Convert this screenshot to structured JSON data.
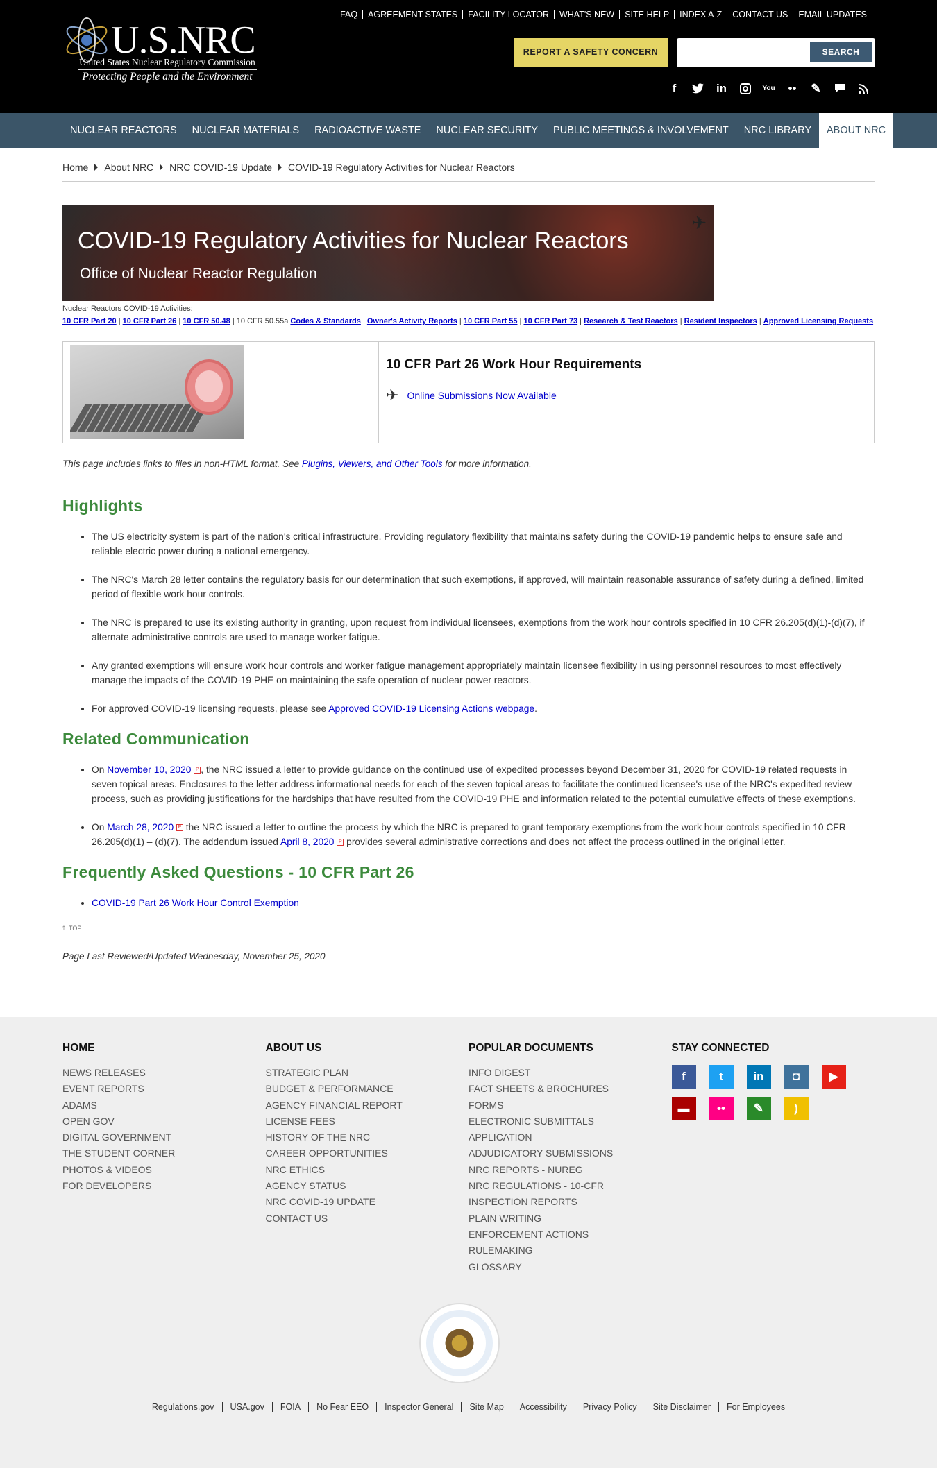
{
  "header": {
    "logo_title": "U.S.NRC",
    "logo_subtitle": "United States Nuclear Regulatory Commission",
    "logo_tagline": "Protecting People and the Environment",
    "utility_links": [
      "FAQ",
      "AGREEMENT STATES",
      "FACILITY LOCATOR",
      "WHAT'S NEW",
      "SITE HELP",
      "INDEX A-Z",
      "CONTACT US",
      "EMAIL UPDATES"
    ],
    "report_button": "REPORT A SAFETY CONCERN",
    "search_button": "SEARCH",
    "search_value": "",
    "social_icons": [
      "facebook-icon",
      "twitter-icon",
      "linkedin-icon",
      "instagram-icon",
      "youtube-icon",
      "flickr-icon",
      "blog-icon",
      "comment-icon",
      "rss-icon"
    ]
  },
  "nav": {
    "items": [
      "NUCLEAR REACTORS",
      "NUCLEAR MATERIALS",
      "RADIOACTIVE WASTE",
      "NUCLEAR SECURITY",
      "PUBLIC MEETINGS & INVOLVEMENT",
      "NRC LIBRARY",
      "ABOUT NRC"
    ],
    "active": "ABOUT NRC"
  },
  "breadcrumb": [
    "Home",
    "About NRC",
    "NRC COVID-19 Update",
    "COVID-19 Regulatory Activities for Nuclear Reactors"
  ],
  "banner": {
    "title": "COVID-19 Regulatory Activities for Nuclear Reactors",
    "subtitle": "Office of Nuclear Reactor Regulation"
  },
  "activities": {
    "label": "Nuclear Reactors COVID-19 Activities:",
    "links": [
      "10 CFR Part 20",
      "10 CFR Part 26",
      "10 CFR 50.48"
    ],
    "plain": "10 CFR 50.55a",
    "links2": [
      "Codes & Standards",
      "Owner's Activity Reports",
      "10 CFR Part 55",
      "10 CFR Part 73",
      "Research & Test Reactors",
      "Resident Inspectors",
      "Approved Licensing Requests"
    ]
  },
  "feature": {
    "title": "10 CFR Part 26 Work Hour Requirements",
    "link": "Online Submissions Now Available"
  },
  "note": {
    "before": "This page includes links to files in non-HTML format. See ",
    "link": "Plugins, Viewers, and Other Tools",
    "after": " for more information."
  },
  "highlights": {
    "heading": "Highlights",
    "items": [
      "The US electricity system is part of the nation's critical infrastructure. Providing regulatory flexibility that maintains safety during the COVID-19 pandemic helps to ensure safe and reliable electric power during a national emergency.",
      "The NRC's March 28 letter contains the regulatory basis for our determination that such exemptions, if approved, will maintain reasonable assurance of safety during a defined, limited period of flexible work hour controls.",
      "The NRC is prepared to use its existing authority in granting, upon request from individual licensees, exemptions from the work hour controls specified in 10 CFR 26.205(d)(1)-(d)(7), if alternate administrative controls are used to manage worker fatigue.",
      "Any granted exemptions will ensure work hour controls and worker fatigue management appropriately maintain licensee flexibility in using personnel resources to most effectively manage the impacts of the COVID-19 PHE on maintaining the safe operation of nuclear power reactors."
    ],
    "last_before": "For approved COVID-19 licensing requests, please see ",
    "last_link": "Approved COVID-19 Licensing Actions webpage",
    "last_after": "."
  },
  "related": {
    "heading": "Related Communication",
    "item1_on": "On ",
    "item1_link": "November 10, 2020",
    "item1_text": ", the NRC issued a letter to provide guidance on the continued use of expedited processes beyond December 31, 2020 for COVID-19 related requests in seven topical areas. Enclosures to the letter address informational needs for each of the seven topical areas to facilitate the continued licensee's use of the NRC's expedited review process, such as providing justifications for the hardships that have resulted from the COVID-19 PHE and information related to the potential cumulative effects of these exemptions.",
    "item2_on": "On ",
    "item2_link": "March 28, 2020",
    "item2_text": " the NRC issued a letter to outline the process by which the NRC is prepared to grant temporary exemptions from the work hour controls specified in 10 CFR 26.205(d)(1) – (d)(7). The addendum issued ",
    "item2_link2": "April 8, 2020",
    "item2_text2": " provides several administrative corrections and does not affect the process outlined in the original letter."
  },
  "faq": {
    "heading": "Frequently Asked Questions - 10 CFR Part 26",
    "link": "COVID-19 Part 26 Work Hour Control Exemption"
  },
  "top_label": "TOP",
  "updated": "Page Last Reviewed/Updated Wednesday, November 25, 2020",
  "footer": {
    "home": {
      "heading": "HOME",
      "links": [
        "NEWS RELEASES",
        "EVENT REPORTS",
        "ADAMS",
        "OPEN GOV",
        "DIGITAL GOVERNMENT",
        "THE STUDENT CORNER",
        "PHOTOS & VIDEOS",
        "FOR DEVELOPERS"
      ]
    },
    "about": {
      "heading": "ABOUT US",
      "links": [
        "STRATEGIC PLAN",
        "BUDGET & PERFORMANCE",
        "AGENCY FINANCIAL REPORT",
        "LICENSE FEES",
        "HISTORY OF THE NRC",
        "CAREER OPPORTUNITIES",
        "NRC ETHICS",
        "AGENCY STATUS",
        "NRC COVID-19 UPDATE",
        "CONTACT US"
      ]
    },
    "popular": {
      "heading": "POPULAR DOCUMENTS",
      "links": [
        "INFO DIGEST",
        "FACT SHEETS & BROCHURES",
        "FORMS",
        "ELECTRONIC SUBMITTALS",
        "APPLICATION",
        "ADJUDICATORY SUBMISSIONS",
        "NRC REPORTS - NUREG",
        "NRC REGULATIONS - 10-CFR",
        "INSPECTION REPORTS",
        "PLAIN WRITING",
        "ENFORCEMENT ACTIONS",
        "RULEMAKING",
        "GLOSSARY"
      ]
    },
    "connected": {
      "heading": "STAY CONNECTED"
    },
    "social": [
      {
        "name": "facebook-icon",
        "color": "#3b5998",
        "glyph": "f"
      },
      {
        "name": "twitter-icon",
        "color": "#1da1f2",
        "glyph": "t"
      },
      {
        "name": "linkedin-icon",
        "color": "#0077b5",
        "glyph": "in"
      },
      {
        "name": "instagram-icon",
        "color": "#3f729b",
        "glyph": "◘"
      },
      {
        "name": "youtube-icon",
        "color": "#e62117",
        "glyph": "▶"
      },
      {
        "name": "comment-icon",
        "color": "#a00",
        "glyph": "▬"
      },
      {
        "name": "flickr-icon",
        "color": "#ff0084",
        "glyph": "••"
      },
      {
        "name": "blog-icon",
        "color": "#2a8a2a",
        "glyph": "✎"
      },
      {
        "name": "rss-icon",
        "color": "#f0c000",
        "glyph": ")"
      }
    ],
    "bottom_links": [
      "Regulations.gov",
      "USA.gov",
      "FOIA",
      "No Fear EEO",
      "Inspector General",
      "Site Map",
      "Accessibility",
      "Privacy Policy",
      "Site Disclaimer",
      "For Employees"
    ]
  }
}
